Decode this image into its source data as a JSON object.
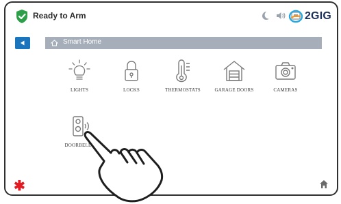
{
  "status": {
    "arm_text": "Ready to Arm",
    "brand": "2GIG",
    "icons": [
      "shield-check-icon",
      "moon-icon",
      "speaker-icon",
      "camera-icon",
      "2gig-logo-icon"
    ]
  },
  "nav": {
    "back_icon": "back-arrow-icon",
    "breadcrumb_icon": "home-icon",
    "breadcrumb_label": "Smart Home"
  },
  "tiles": [
    {
      "label": "LIGHTS",
      "icon": "lightbulb-icon"
    },
    {
      "label": "LOCKS",
      "icon": "lock-icon"
    },
    {
      "label": "THERMOSTATS",
      "icon": "thermostat-icon"
    },
    {
      "label": "GARAGE DOORS",
      "icon": "garage-icon"
    },
    {
      "label": "CAMERAS",
      "icon": "camera-icon"
    },
    {
      "label": "DOORBELLS",
      "icon": "doorbell-icon"
    }
  ],
  "footer": {
    "emergency_icon": "asterisk-icon",
    "home_icon": "home-icon"
  },
  "colors": {
    "ready_green": "#2e9f49",
    "accent_blue": "#1b75bc",
    "breadcrumb_gray": "#a6afb9",
    "emergency_red": "#e21b23"
  }
}
